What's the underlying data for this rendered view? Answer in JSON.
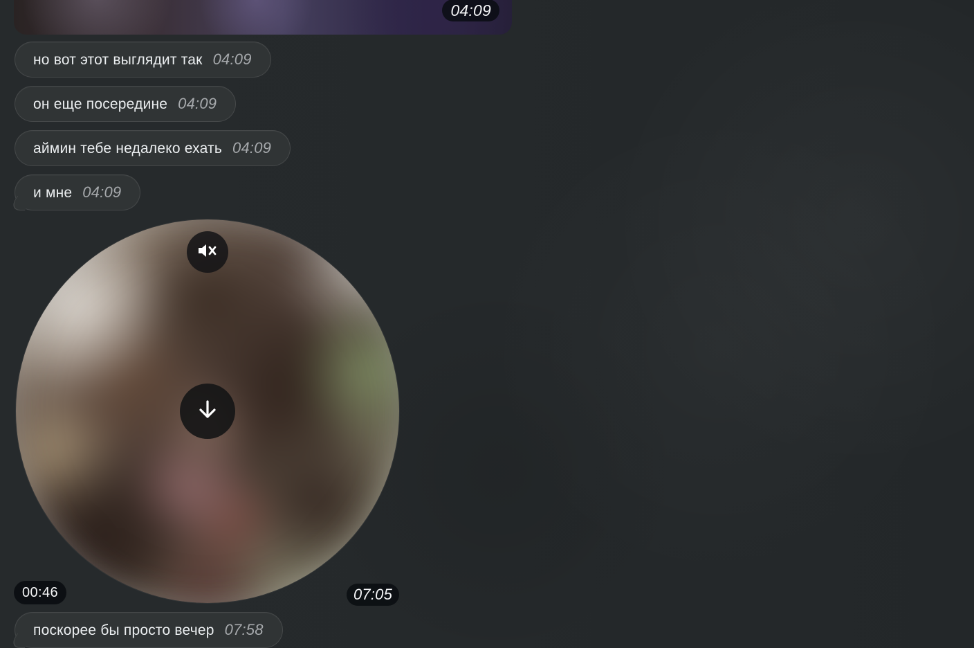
{
  "chat": {
    "top_media": {
      "time": "04:09"
    },
    "messages": [
      {
        "text": "но вот этот выглядит так",
        "time": "04:09"
      },
      {
        "text": "он еще посередине",
        "time": "04:09"
      },
      {
        "text": "аймин тебе недалеко ехать",
        "time": "04:09"
      },
      {
        "text": "и мне",
        "time": "04:09"
      },
      {
        "text": "поскорее бы просто вечер",
        "time": "07:58"
      }
    ],
    "video_note": {
      "duration": "00:46",
      "time": "07:05",
      "icons": {
        "mute": "muted-speaker-icon",
        "download": "download-arrow-icon"
      }
    }
  }
}
